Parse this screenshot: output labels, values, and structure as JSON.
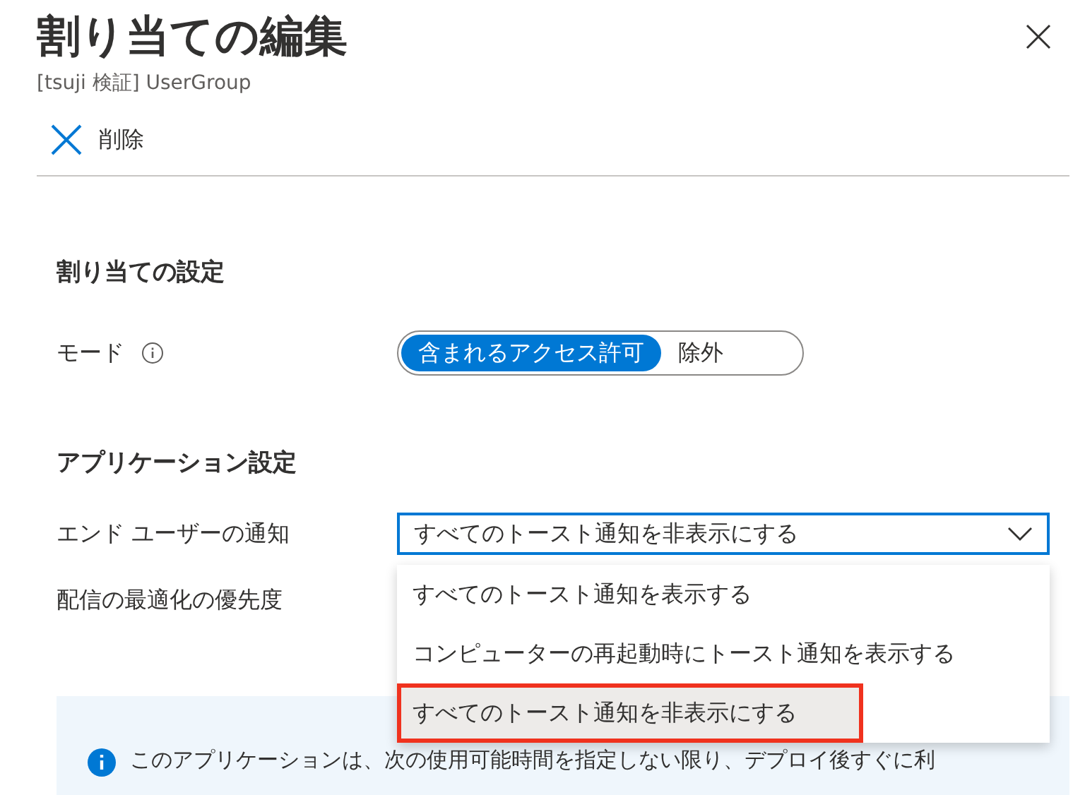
{
  "header": {
    "title": "割り当ての編集",
    "subtitle": "[tsuji 検証] UserGroup"
  },
  "toolbar": {
    "delete_label": "削除"
  },
  "assignment_settings": {
    "heading": "割り当ての設定",
    "mode_label": "モード",
    "mode_options": [
      {
        "label": "含まれるアクセス許可",
        "selected": true
      },
      {
        "label": "除外",
        "selected": false
      }
    ]
  },
  "app_settings": {
    "heading": "アプリケーション設定",
    "notification_label": "エンド ユーザーの通知",
    "notification_value": "すべてのトースト通知を非表示にする",
    "dropdown_options": [
      {
        "label": "すべてのトースト通知を表示する",
        "selected": false,
        "highlighted": false
      },
      {
        "label": "コンピューターの再起動時にトースト通知を表示する",
        "selected": false,
        "highlighted": false
      },
      {
        "label": "すべてのトースト通知を非表示にする",
        "selected": true,
        "highlighted": true
      }
    ],
    "priority_label": "配信の最適化の優先度"
  },
  "info_message": "このアプリケーションは、次の使用可能時間を指定しない限り、デプロイ後すぐに利"
}
